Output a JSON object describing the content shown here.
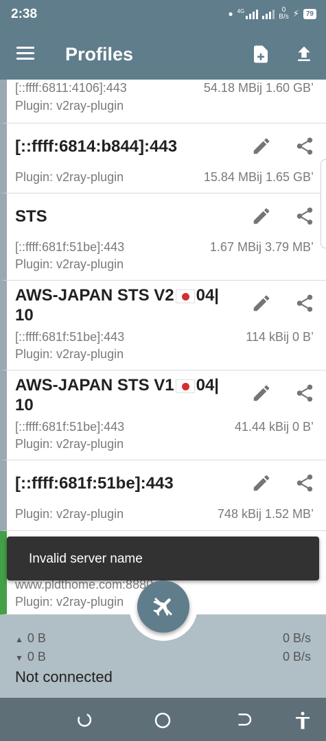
{
  "status_bar": {
    "time": "2:38",
    "net_label": "4G",
    "speed_value": "0",
    "speed_unit": "B/s",
    "battery": "79"
  },
  "toolbar": {
    "title": "Profiles",
    "icons": [
      "menu-icon",
      "add-file-icon",
      "upload-icon"
    ]
  },
  "profiles": [
    {
      "name": "",
      "address": "[::ffff:6811:4106]:443",
      "plugin": "Plugin: v2ray-plugin",
      "traffic": "54.18 MBij  1.60 GB’"
    },
    {
      "name": "[::ffff:6814:b844]:443",
      "address": "",
      "plugin": "Plugin: v2ray-plugin",
      "traffic": "15.84 MBij  1.65 GB’"
    },
    {
      "name": "STS",
      "address": "[::ffff:681f:51be]:443",
      "plugin": "Plugin: v2ray-plugin",
      "traffic": "1.67 MBij  3.79 MB’"
    },
    {
      "name_line1": "AWS-JAPAN STS V2",
      "name_flag_suffix": "04|",
      "name_line2": "10",
      "address": "[::ffff:681f:51be]:443",
      "plugin": "Plugin: v2ray-plugin",
      "traffic": "114 kBij  0 B’"
    },
    {
      "name_line1": "AWS-JAPAN STS V1",
      "name_flag_suffix": "04|",
      "name_line2": "10",
      "address": "[::ffff:681f:51be]:443",
      "plugin": "Plugin: v2ray-plugin",
      "traffic": "41.44 kBij  0 B’"
    },
    {
      "name": "[::ffff:681f:51be]:443",
      "address": "",
      "plugin": "Plugin: v2ray-plugin",
      "traffic": "748 kBij  1.52 MB’"
    },
    {
      "name": "",
      "address": "www.pldthome.com:8880",
      "plugin": "Plugin: v2ray-plugin",
      "traffic": ""
    }
  ],
  "snackbar": {
    "message": "Invalid server name"
  },
  "stats": {
    "tx_total": "0 B",
    "rx_total": "0 B",
    "tx_rate": "0 B/s",
    "rx_rate": "0 B/s",
    "connection_status": "Not connected"
  },
  "colors": {
    "primary": "#607d8b",
    "connected_accent": "#43a047",
    "idle_accent": "#9aa9b1",
    "snackbar_bg": "#323232",
    "stats_bg": "#b0bec5"
  }
}
